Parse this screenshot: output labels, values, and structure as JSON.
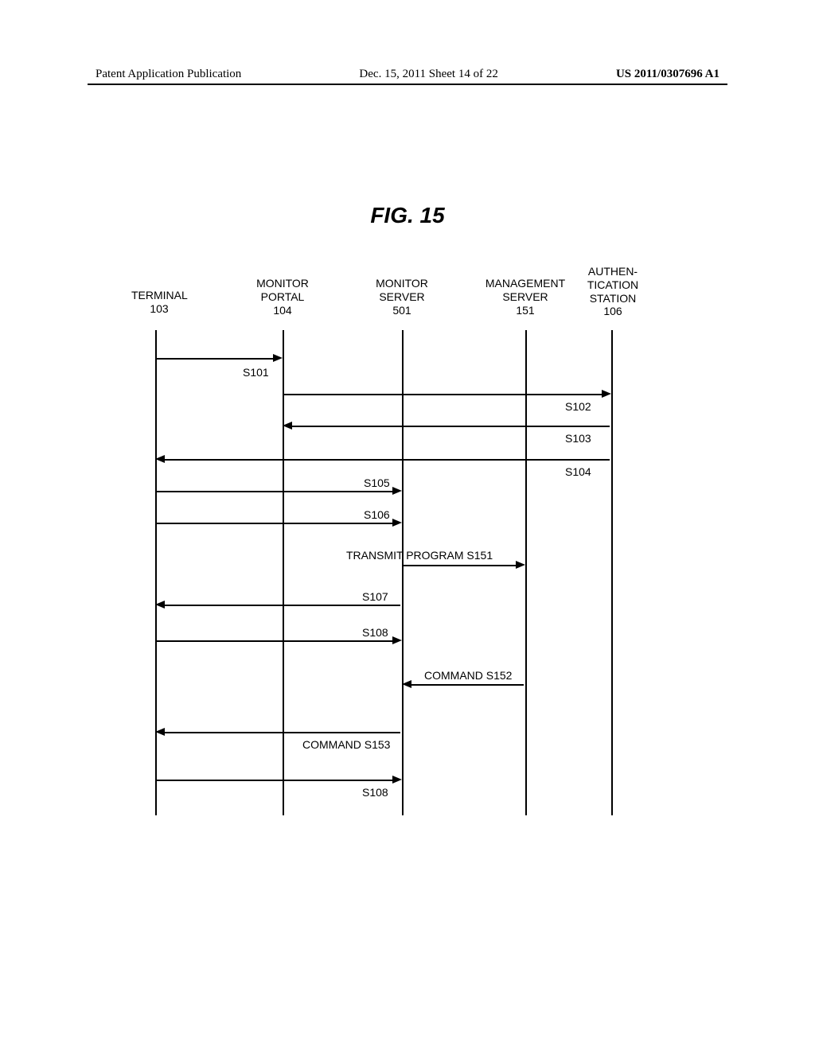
{
  "header": {
    "left": "Patent Application Publication",
    "center": "Dec. 15, 2011  Sheet 14 of 22",
    "right": "US 2011/0307696 A1"
  },
  "figure_title": "FIG. 15",
  "actors": {
    "terminal": {
      "label": "TERMINAL",
      "id": "103"
    },
    "monitor_portal": {
      "label": "MONITOR\nPORTAL",
      "id": "104"
    },
    "monitor_server": {
      "label": "MONITOR\nSERVER",
      "id": "501"
    },
    "management_server": {
      "label": "MANAGEMENT\nSERVER",
      "id": "151"
    },
    "authentication": {
      "label": "AUTHEN-\nTICATION\nSTATION",
      "id": "106"
    }
  },
  "messages": {
    "s101": "S101",
    "s102": "S102",
    "s103": "S103",
    "s104": "S104",
    "s105": "S105",
    "s106": "S106",
    "s107": "S107",
    "s108_1": "S108",
    "s108_2": "S108",
    "s151": "TRANSMIT PROGRAM  S151",
    "s152": "COMMAND  S152",
    "s153": "COMMAND  S153"
  }
}
